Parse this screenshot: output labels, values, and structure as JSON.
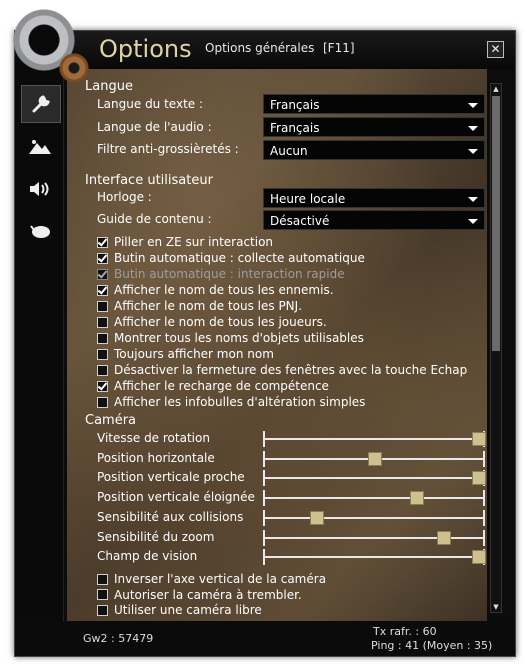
{
  "window": {
    "title": "Options",
    "subtitle": "Options générales",
    "hotkey": "[F11]",
    "close": "✕"
  },
  "sidebar": {
    "tabs": [
      {
        "name": "general",
        "icon": "wrench-icon",
        "active": true
      },
      {
        "name": "graphics",
        "icon": "mountain-icon",
        "active": false
      },
      {
        "name": "sound",
        "icon": "speaker-icon",
        "active": false
      },
      {
        "name": "controls",
        "icon": "mouse-icon",
        "active": false
      }
    ]
  },
  "langue": {
    "header": "Langue",
    "text_label": "Langue du texte :",
    "text_value": "Français",
    "audio_label": "Langue de l'audio :",
    "audio_value": "Français",
    "filter_label": "Filtre anti-grossièretés :",
    "filter_value": "Aucun"
  },
  "interface": {
    "header": "Interface utilisateur",
    "clock_label": "Horloge :",
    "clock_value": "Heure locale",
    "guide_label": "Guide de contenu :",
    "guide_value": "Désactivé",
    "checkboxes": [
      {
        "label": "Piller en ZE sur interaction",
        "checked": true,
        "disabled": false
      },
      {
        "label": "Butin automatique : collecte automatique",
        "checked": true,
        "disabled": false
      },
      {
        "label": "Butin automatique : interaction rapide",
        "checked": true,
        "disabled": true
      },
      {
        "label": "Afficher le nom de tous les ennemis.",
        "checked": true,
        "disabled": false
      },
      {
        "label": "Afficher le nom de tous les PNJ.",
        "checked": false,
        "disabled": false
      },
      {
        "label": "Afficher le nom de tous les joueurs.",
        "checked": false,
        "disabled": false
      },
      {
        "label": "Montrer tous les noms d'objets utilisables",
        "checked": false,
        "disabled": false
      },
      {
        "label": "Toujours afficher mon nom",
        "checked": false,
        "disabled": false
      },
      {
        "label": "Désactiver la fermeture des fenêtres avec la touche Echap",
        "checked": false,
        "disabled": false
      },
      {
        "label": "Afficher le recharge de compétence",
        "checked": true,
        "disabled": false
      },
      {
        "label": "Afficher les infobulles d'altération simples",
        "checked": false,
        "disabled": false
      }
    ]
  },
  "camera": {
    "header": "Caméra",
    "sliders": [
      {
        "label": "Vitesse de rotation",
        "value": 0.97
      },
      {
        "label": "Position horizontale",
        "value": 0.5
      },
      {
        "label": "Position verticale proche",
        "value": 0.97
      },
      {
        "label": "Position verticale éloignée",
        "value": 0.69
      },
      {
        "label": "Sensibilité aux collisions",
        "value": 0.24
      },
      {
        "label": "Sensibilité du zoom",
        "value": 0.81
      },
      {
        "label": "Champ de vision",
        "value": 0.97
      }
    ],
    "checkboxes": [
      {
        "label": "Inverser l'axe vertical de la caméra",
        "checked": false
      },
      {
        "label": "Autoriser la caméra à trembler.",
        "checked": false
      },
      {
        "label": "Utiliser une caméra libre",
        "checked": false
      }
    ]
  },
  "footer": {
    "build": "Gw2 : 57479",
    "fps": "Tx rafr. : 60",
    "ping": "Ping : 41 (Moyen : 35)"
  }
}
